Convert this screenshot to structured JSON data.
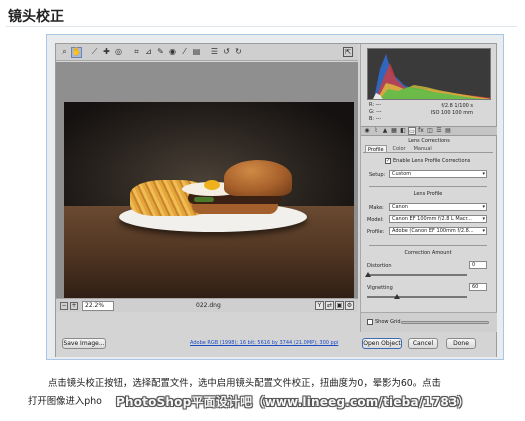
{
  "article": {
    "heading": "镜头校正",
    "caption_line1": "点击镜头校正按钮，选择配置文件，选中启用镜头配置文件校正，扭曲度为0，晕影为60。点击",
    "caption_line2_prefix": "打开图像进入pho",
    "watermark": "PhotoShop平面设计吧（www.lineeg.com/tieba/1783）"
  },
  "dialog": {
    "toolbar": {
      "tools": [
        {
          "name": "zoom-tool-icon",
          "glyph": "⌕",
          "active": false
        },
        {
          "name": "hand-tool-icon",
          "glyph": "✋",
          "active": true
        },
        {
          "name": "white-balance-icon",
          "glyph": "⟋",
          "active": false
        },
        {
          "name": "color-sampler-icon",
          "glyph": "✚",
          "active": false
        },
        {
          "name": "targeted-adjust-icon",
          "glyph": "◎",
          "active": false
        },
        {
          "name": "crop-tool-icon",
          "glyph": "⌗",
          "active": false
        },
        {
          "name": "straighten-icon",
          "glyph": "⊿",
          "active": false
        },
        {
          "name": "spot-removal-icon",
          "glyph": "✎",
          "active": false
        },
        {
          "name": "red-eye-icon",
          "glyph": "◉",
          "active": false
        },
        {
          "name": "adjustment-brush-icon",
          "glyph": "⁄",
          "active": false
        },
        {
          "name": "graduated-filter-icon",
          "glyph": "▤",
          "active": false
        },
        {
          "name": "preferences-icon",
          "glyph": "☰",
          "active": false
        },
        {
          "name": "rotate-left-icon",
          "glyph": "↺",
          "active": false
        },
        {
          "name": "rotate-right-icon",
          "glyph": "↻",
          "active": false
        }
      ],
      "fullscreen_glyph": "⇱"
    },
    "status": {
      "zoom_value": "22.2%",
      "filename": "022.dng"
    },
    "readout": {
      "r": "R:",
      "g": "G:",
      "b": "B:",
      "dashes": "---",
      "aperture_shutter": "f/2.8   1/100 s",
      "iso_focal": "ISO 100    100 mm"
    },
    "panel_title": "Lens Corrections",
    "subtabs": [
      "Profile",
      "Color",
      "Manual"
    ],
    "enable_profile_label": "Enable Lens Profile Corrections",
    "setup_label": "Setup:",
    "setup_value": "Custom",
    "lens_profile_title": "Lens Profile",
    "make_label": "Make:",
    "make_value": "Canon",
    "model_label": "Model:",
    "model_value": "Canon EF 100mm f/2.8 L Macr...",
    "profile_label": "Profile:",
    "profile_value": "Adobe (Canon EF 100mm f/2.8...",
    "correction_title": "Correction Amount",
    "distortion_label": "Distortion",
    "distortion_value": "0",
    "distortion_level": 0,
    "vignetting_label": "Vignetting",
    "vignetting_value": "60",
    "vignetting_level": 0.3,
    "show_grid_label": "Show Grid",
    "buttons": {
      "save": "Save Image...",
      "open": "Open Object",
      "cancel": "Cancel",
      "done": "Done"
    },
    "workflow_link": "Adobe RGB (1998); 16 bit; 5616 by 3744 (21.0MP); 300 ppi"
  }
}
